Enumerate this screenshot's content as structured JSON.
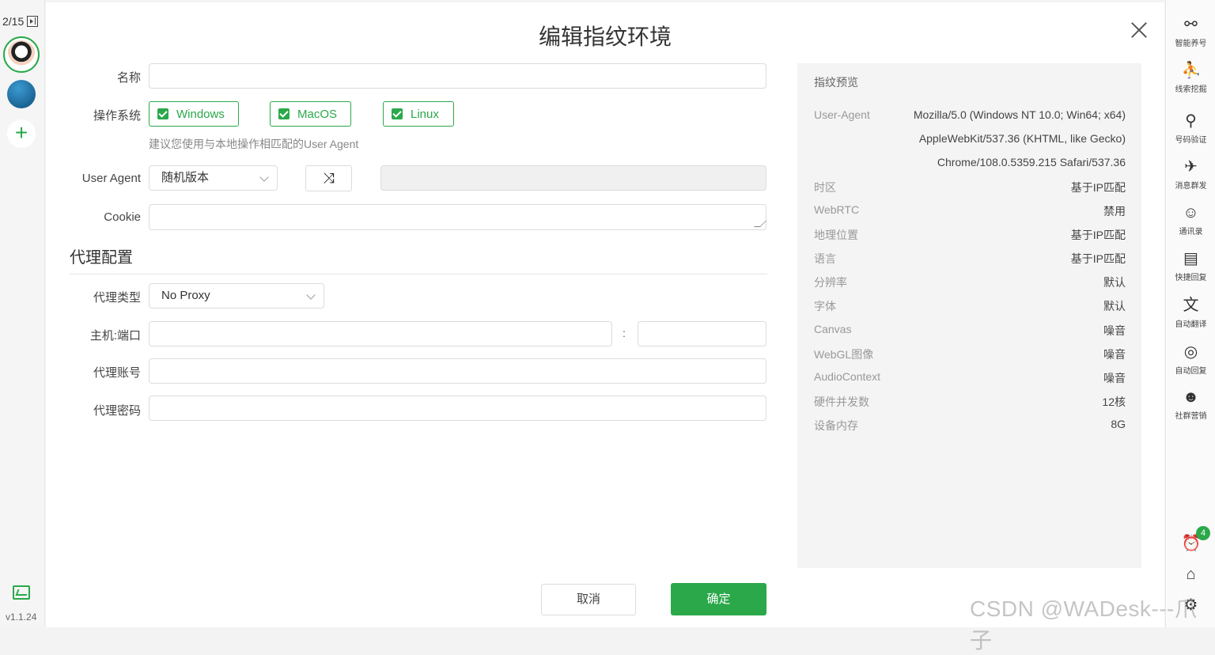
{
  "left_rail": {
    "counter": "2/15",
    "version": "v1.1.24",
    "add_label": "+"
  },
  "dialog": {
    "title": "编辑指纹环境",
    "form": {
      "name_label": "名称",
      "name_value": "",
      "os_label": "操作系统",
      "os_options": [
        {
          "label": "Windows",
          "checked": true
        },
        {
          "label": "MacOS",
          "checked": true
        },
        {
          "label": "Linux",
          "checked": true
        }
      ],
      "os_hint": "建议您使用与本地操作相匹配的User Agent",
      "ua_label": "User Agent",
      "ua_select": "随机版本",
      "ua_value": "",
      "cookie_label": "Cookie",
      "cookie_value": ""
    },
    "proxy": {
      "section_title": "代理配置",
      "type_label": "代理类型",
      "type_value": "No Proxy",
      "host_label": "主机:端口",
      "host_value": "",
      "port_separator": ":",
      "port_value": "",
      "account_label": "代理账号",
      "account_value": "",
      "password_label": "代理密码",
      "password_value": ""
    },
    "preview": {
      "title": "指纹预览",
      "user_agent_key": "User-Agent",
      "user_agent_lines": [
        "Mozilla/5.0 (Windows NT 10.0; Win64; x64)",
        "AppleWebKit/537.36 (KHTML, like Gecko)",
        "Chrome/108.0.5359.215 Safari/537.36"
      ],
      "rows": [
        {
          "key": "时区",
          "value": "基于IP匹配"
        },
        {
          "key": "WebRTC",
          "value": "禁用"
        },
        {
          "key": "地理位置",
          "value": "基于IP匹配"
        },
        {
          "key": "语言",
          "value": "基于IP匹配"
        },
        {
          "key": "分辨率",
          "value": "默认"
        },
        {
          "key": "字体",
          "value": "默认"
        },
        {
          "key": "Canvas",
          "value": "噪音"
        },
        {
          "key": "WebGL图像",
          "value": "噪音"
        },
        {
          "key": "AudioContext",
          "value": "噪音"
        },
        {
          "key": "硬件并发数",
          "value": "12核"
        },
        {
          "key": "设备内存",
          "value": "8G"
        }
      ]
    },
    "buttons": {
      "cancel": "取消",
      "ok": "确定"
    }
  },
  "right_rail": {
    "items": [
      {
        "icon": "share-nodes-icon",
        "label": "智能养号"
      },
      {
        "icon": "person-pin-icon",
        "label": "线索挖掘"
      },
      {
        "icon": "user-search-icon",
        "label": "号码验证"
      },
      {
        "icon": "paper-plane-icon",
        "label": "消息群发"
      },
      {
        "icon": "contacts-icon",
        "label": "通讯录"
      },
      {
        "icon": "quick-reply-icon",
        "label": "快捷回复"
      },
      {
        "icon": "translate-icon",
        "label": "自动翻译"
      },
      {
        "icon": "auto-reply-icon",
        "label": "自动回复"
      },
      {
        "icon": "group-icon",
        "label": "社群营销"
      }
    ],
    "alarm_badge": "4"
  },
  "watermark": "CSDN @WADesk---爪子",
  "colors": {
    "accent": "#2aa84a",
    "preview_bg": "#f4f4f4"
  }
}
